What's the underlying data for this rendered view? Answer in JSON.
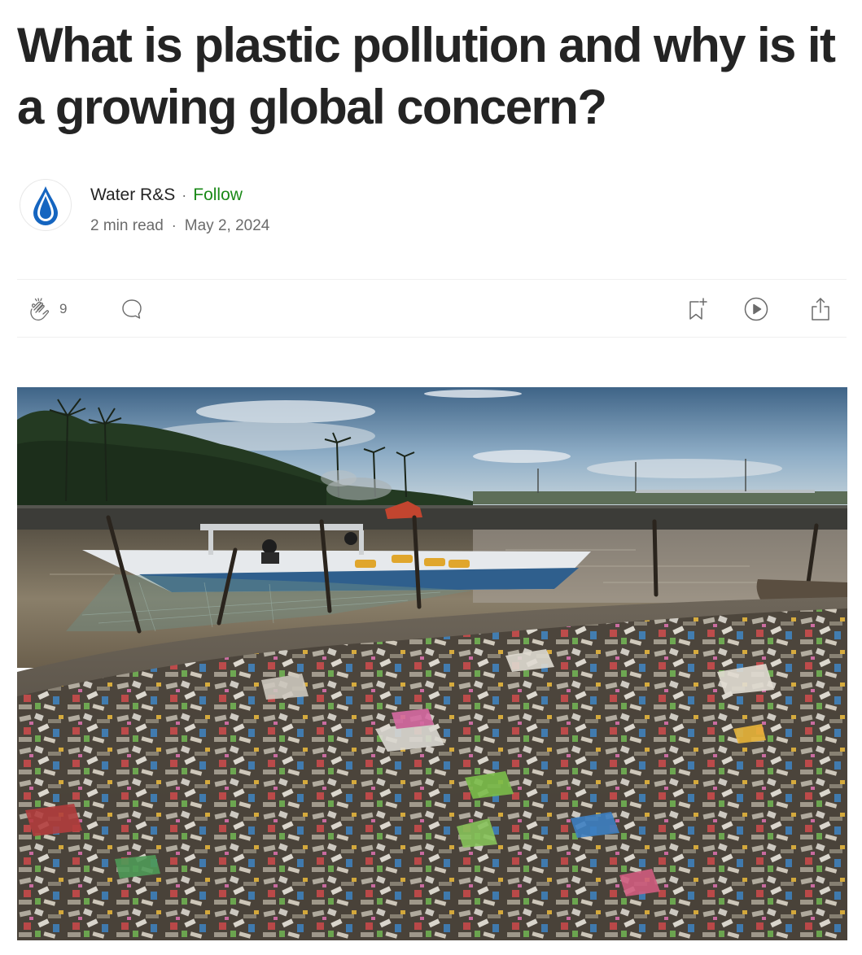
{
  "article": {
    "title": "What is plastic pollution and why is it a growing global concern?"
  },
  "author": {
    "name": "Water R&S",
    "separator": "·",
    "follow_label": "Follow",
    "avatar_icon": "water-drop-icon"
  },
  "meta": {
    "read_time": "2 min read",
    "separator": "·",
    "date": "May 2, 2024"
  },
  "actions": {
    "clap_count": "9",
    "icons": [
      "clap-icon",
      "comment-icon",
      "bookmark-add-icon",
      "play-listen-icon",
      "share-icon"
    ]
  },
  "colors": {
    "follow_green": "#1a8917",
    "text_primary": "#242424",
    "text_secondary": "#6b6b6b",
    "divider": "#f0f0f0",
    "drop_blue": "#1565c0"
  }
}
